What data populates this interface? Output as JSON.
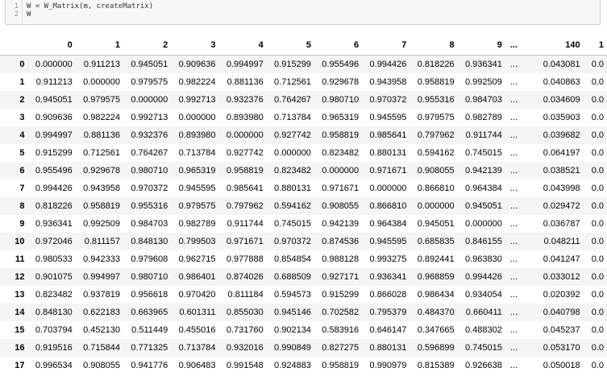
{
  "code": {
    "line_numbers": [
      "1",
      "2"
    ],
    "lines": [
      "W = W_Matrix(m, createMatrix)",
      "W"
    ]
  },
  "table": {
    "columns": [
      "",
      "0",
      "1",
      "2",
      "3",
      "4",
      "5",
      "6",
      "7",
      "8",
      "9",
      "...",
      "140",
      "1"
    ],
    "rows": [
      {
        "index": "0",
        "cells": [
          "0.000000",
          "0.911213",
          "0.945051",
          "0.909636",
          "0.994997",
          "0.915299",
          "0.955496",
          "0.994426",
          "0.818226",
          "0.936341",
          "...",
          "0.043081",
          "0.0"
        ]
      },
      {
        "index": "1",
        "cells": [
          "0.911213",
          "0.000000",
          "0.979575",
          "0.982224",
          "0.881136",
          "0.712561",
          "0.929678",
          "0.943958",
          "0.958819",
          "0.992509",
          "...",
          "0.040863",
          "0.0"
        ]
      },
      {
        "index": "2",
        "cells": [
          "0.945051",
          "0.979575",
          "0.000000",
          "0.992713",
          "0.932376",
          "0.764267",
          "0.980710",
          "0.970372",
          "0.955316",
          "0.984703",
          "...",
          "0.034609",
          "0.0"
        ]
      },
      {
        "index": "3",
        "cells": [
          "0.909636",
          "0.982224",
          "0.992713",
          "0.000000",
          "0.893980",
          "0.713784",
          "0.965319",
          "0.945595",
          "0.979575",
          "0.982789",
          "...",
          "0.035903",
          "0.0"
        ]
      },
      {
        "index": "4",
        "cells": [
          "0.994997",
          "0.881136",
          "0.932376",
          "0.893980",
          "0.000000",
          "0.927742",
          "0.958819",
          "0.985641",
          "0.797962",
          "0.911744",
          "...",
          "0.039682",
          "0.0"
        ]
      },
      {
        "index": "5",
        "cells": [
          "0.915299",
          "0.712561",
          "0.764267",
          "0.713784",
          "0.927742",
          "0.000000",
          "0.823482",
          "0.880131",
          "0.594162",
          "0.745015",
          "...",
          "0.064197",
          "0.0"
        ]
      },
      {
        "index": "6",
        "cells": [
          "0.955496",
          "0.929678",
          "0.980710",
          "0.965319",
          "0.958819",
          "0.823482",
          "0.000000",
          "0.971671",
          "0.908055",
          "0.942139",
          "...",
          "0.038521",
          "0.0"
        ]
      },
      {
        "index": "7",
        "cells": [
          "0.994426",
          "0.943958",
          "0.970372",
          "0.945595",
          "0.985641",
          "0.880131",
          "0.971671",
          "0.000000",
          "0.866810",
          "0.964384",
          "...",
          "0.043998",
          "0.0"
        ]
      },
      {
        "index": "8",
        "cells": [
          "0.818226",
          "0.958819",
          "0.955316",
          "0.979575",
          "0.797962",
          "0.594162",
          "0.908055",
          "0.866810",
          "0.000000",
          "0.945051",
          "...",
          "0.029472",
          "0.0"
        ]
      },
      {
        "index": "9",
        "cells": [
          "0.936341",
          "0.992509",
          "0.984703",
          "0.982789",
          "0.911744",
          "0.745015",
          "0.942139",
          "0.964384",
          "0.945051",
          "0.000000",
          "...",
          "0.036787",
          "0.0"
        ]
      },
      {
        "index": "10",
        "cells": [
          "0.972046",
          "0.811157",
          "0.848130",
          "0.799503",
          "0.971671",
          "0.970372",
          "0.874536",
          "0.945595",
          "0.685835",
          "0.846155",
          "...",
          "0.048211",
          "0.0"
        ]
      },
      {
        "index": "11",
        "cells": [
          "0.980533",
          "0.942333",
          "0.979608",
          "0.962715",
          "0.977888",
          "0.854854",
          "0.988128",
          "0.993275",
          "0.892441",
          "0.963830",
          "...",
          "0.041247",
          "0.0"
        ]
      },
      {
        "index": "12",
        "cells": [
          "0.901075",
          "0.994997",
          "0.980710",
          "0.986401",
          "0.874026",
          "0.688509",
          "0.927171",
          "0.936341",
          "0.968859",
          "0.994426",
          "...",
          "0.033012",
          "0.0"
        ]
      },
      {
        "index": "13",
        "cells": [
          "0.823482",
          "0.937819",
          "0.956618",
          "0.970420",
          "0.811184",
          "0.594573",
          "0.915299",
          "0.866028",
          "0.986434",
          "0.934054",
          "...",
          "0.020392",
          "0.0"
        ]
      },
      {
        "index": "14",
        "cells": [
          "0.848130",
          "0.622183",
          "0.663965",
          "0.601311",
          "0.855030",
          "0.945146",
          "0.702582",
          "0.795379",
          "0.484370",
          "0.660411",
          "...",
          "0.040798",
          "0.0"
        ]
      },
      {
        "index": "15",
        "cells": [
          "0.703794",
          "0.452130",
          "0.511449",
          "0.455016",
          "0.731760",
          "0.902134",
          "0.583916",
          "0.646147",
          "0.347665",
          "0.488302",
          "...",
          "0.045237",
          "0.0"
        ]
      },
      {
        "index": "16",
        "cells": [
          "0.919516",
          "0.715844",
          "0.771325",
          "0.713784",
          "0.932016",
          "0.990849",
          "0.827275",
          "0.880131",
          "0.596899",
          "0.745015",
          "...",
          "0.053170",
          "0.0"
        ]
      },
      {
        "index": "17",
        "cells": [
          "0.996534",
          "0.908055",
          "0.941776",
          "0.906483",
          "0.991548",
          "0.924883",
          "0.958819",
          "0.990979",
          "0.815389",
          "0.926638",
          "...",
          "0.050018",
          "0.0"
        ]
      }
    ]
  }
}
